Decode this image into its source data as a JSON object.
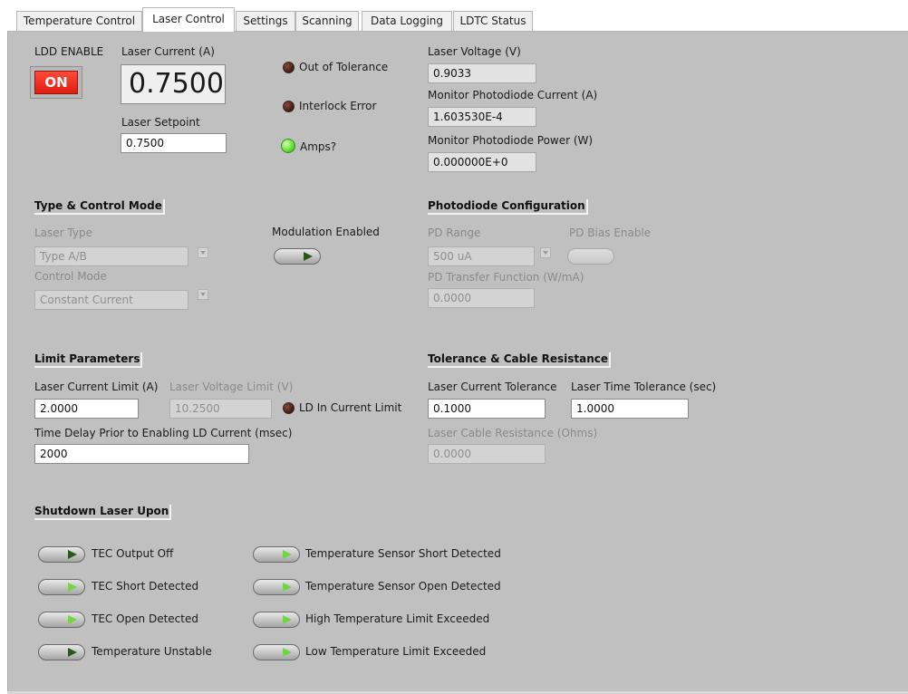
{
  "tabs": [
    "Temperature Control",
    "Laser Control",
    "Settings",
    "Scanning",
    "Data Logging",
    "LDTC Status"
  ],
  "active_tab": "Laser Control",
  "ldd": {
    "enable_label": "LDD ENABLE",
    "enable_state": "ON",
    "current_label": "Laser Current (A)",
    "current_value": "0.7500",
    "setpoint_label": "Laser Setpoint",
    "setpoint_value": "0.7500"
  },
  "indicators": {
    "out_of_tolerance": "Out of Tolerance",
    "interlock_error": "Interlock Error",
    "amps": "Amps?"
  },
  "readings": {
    "laser_voltage_label": "Laser Voltage (V)",
    "laser_voltage_value": "0.9033",
    "pd_current_label": "Monitor Photodiode Current (A)",
    "pd_current_value": "1.603530E-4",
    "pd_power_label": "Monitor Photodiode Power (W)",
    "pd_power_value": "0.000000E+0"
  },
  "type_control": {
    "section": "Type & Control Mode",
    "laser_type_label": "Laser Type",
    "laser_type_value": "Type A/B",
    "control_mode_label": "Control Mode",
    "control_mode_value": "Constant Current",
    "modulation_label": "Modulation Enabled"
  },
  "photodiode": {
    "section": "Photodiode Configuration",
    "pd_range_label": "PD Range",
    "pd_range_value": "500 uA",
    "pd_bias_label": "PD Bias Enable",
    "transfer_label": "PD Transfer Function (W/mA)",
    "transfer_value": "0.0000"
  },
  "limits": {
    "section": "Limit Parameters",
    "current_limit_label": "Laser Current Limit (A)",
    "current_limit_value": "2.0000",
    "voltage_limit_label": "Laser Voltage Limit (V)",
    "voltage_limit_value": "10.2500",
    "in_limit_label": "LD In Current Limit",
    "delay_label": "Time Delay Prior to Enabling LD Current (msec)",
    "delay_value": "2000"
  },
  "tolerance": {
    "section": "Tolerance & Cable Resistance",
    "current_tol_label": "Laser Current Tolerance",
    "current_tol_value": "0.1000",
    "time_tol_label": "Laser Time Tolerance (sec)",
    "time_tol_value": "1.0000",
    "cable_label": "Laser Cable Resistance (Ohms)",
    "cable_value": "0.0000"
  },
  "shutdown": {
    "section": "Shutdown Laser Upon",
    "left": [
      "TEC Output Off",
      "TEC Short Detected",
      "TEC Open Detected",
      "Temperature Unstable"
    ],
    "right": [
      "Temperature Sensor Short Detected",
      "Temperature Sensor Open Detected",
      "High Temperature Limit Exceeded",
      "Low Temperature Limit Exceeded"
    ]
  }
}
